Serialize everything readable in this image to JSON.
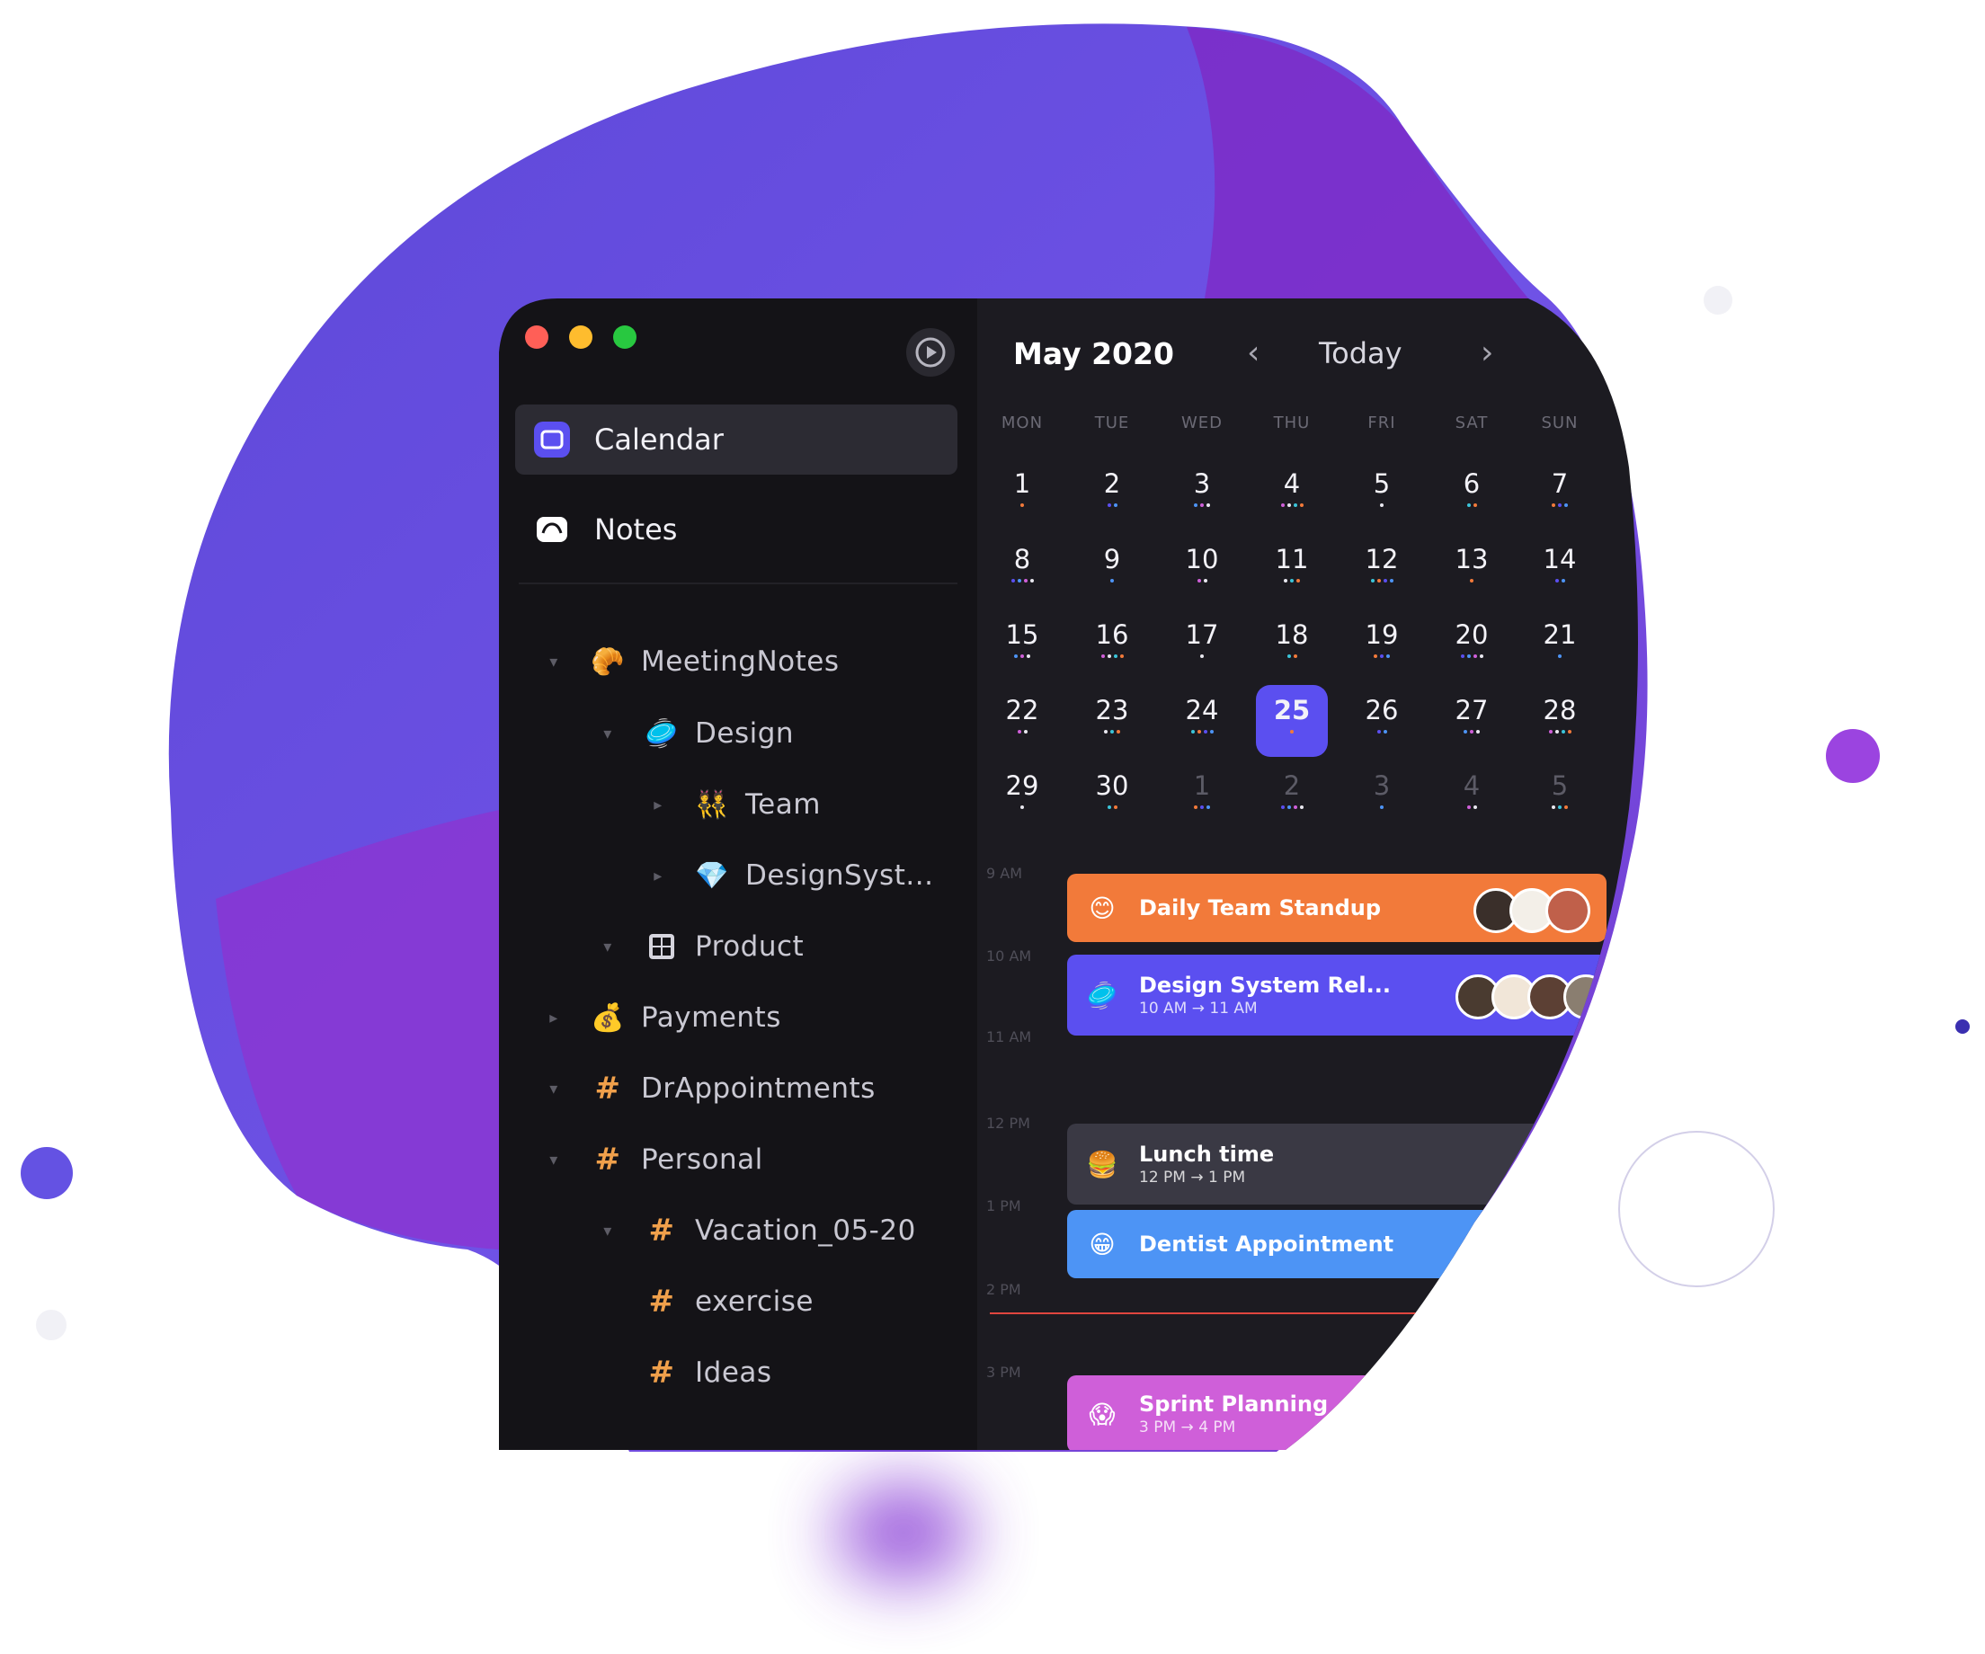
{
  "colors": {
    "accent": "#5b4ff0",
    "blob_primary": "#6a4ee0",
    "blob_secondary": "#8a36d2",
    "sidebar_bg": "#141317",
    "main_bg": "#1c1b21",
    "traffic_red": "#ff5f57",
    "traffic_yellow": "#febc2e",
    "traffic_green": "#28c840"
  },
  "window": {
    "controls": [
      "close",
      "minimize",
      "maximize"
    ],
    "play_icon": "play-circle-icon"
  },
  "sidebar": {
    "nav": [
      {
        "label": "Calendar",
        "icon": "calendar-icon",
        "active": true
      },
      {
        "label": "Notes",
        "icon": "cloud-notes-icon",
        "active": false
      }
    ],
    "tree": [
      {
        "label": "MeetingNotes",
        "icon": "🥐",
        "expanded": true
      },
      {
        "label": "Design",
        "icon": "🥏",
        "expanded": true
      },
      {
        "label": "Team",
        "icon": "👯",
        "expanded": false
      },
      {
        "label": "DesignSyst...",
        "icon": "💎",
        "expanded": false
      },
      {
        "label": "Product",
        "icon": "grid-icon",
        "expanded": true
      },
      {
        "label": "Payments",
        "icon": "💰",
        "expanded": false
      },
      {
        "label": "DrAppointments",
        "icon": "#",
        "expanded": true
      },
      {
        "label": "Personal",
        "icon": "#",
        "expanded": true
      },
      {
        "label": "Vacation_05-20",
        "icon": "#",
        "expanded": true
      },
      {
        "label": "exercise",
        "icon": "#",
        "expanded": false
      },
      {
        "label": "Ideas",
        "icon": "#",
        "expanded": false
      }
    ]
  },
  "calendar": {
    "month_title": "May 2020",
    "today_label": "Today",
    "prev_icon": "chevron-left-icon",
    "next_icon": "chevron-right-icon",
    "weekdays": [
      "MON",
      "TUE",
      "WED",
      "THU",
      "FRI",
      "SAT",
      "SUN"
    ],
    "weeks": [
      [
        "1",
        "2",
        "3",
        "4",
        "5",
        "6",
        "7"
      ],
      [
        "8",
        "9",
        "10",
        "11",
        "12",
        "13",
        "14"
      ],
      [
        "15",
        "16",
        "17",
        "18",
        "19",
        "20",
        "21"
      ],
      [
        "22",
        "23",
        "24",
        "25",
        "26",
        "27",
        "28"
      ],
      [
        "29",
        "30",
        "1",
        "2",
        "3",
        "4",
        "5"
      ]
    ],
    "selected_day": "25",
    "time_labels": [
      "9 AM",
      "10 AM",
      "11 AM",
      "12 PM",
      "1 PM",
      "2 PM",
      "3 PM"
    ],
    "events": [
      {
        "title": "Daily Team Standup",
        "sub": "",
        "emoji": "😊",
        "color": "#f27a3a"
      },
      {
        "title": "Design System Rel...",
        "sub": "10 AM → 11 AM",
        "emoji": "🥏",
        "color": "#5b4ff0"
      },
      {
        "title": "Lunch time",
        "sub": "12 PM → 1 PM",
        "emoji": "🍔",
        "color": "#3a3944"
      },
      {
        "title": "Dentist Appointment",
        "sub": "",
        "emoji": "😁",
        "color": "#4d94f5"
      },
      {
        "title": "Sprint Planning",
        "sub": "3 PM → 4 PM",
        "emoji": "😱",
        "color": "#cf5fd9"
      }
    ]
  }
}
